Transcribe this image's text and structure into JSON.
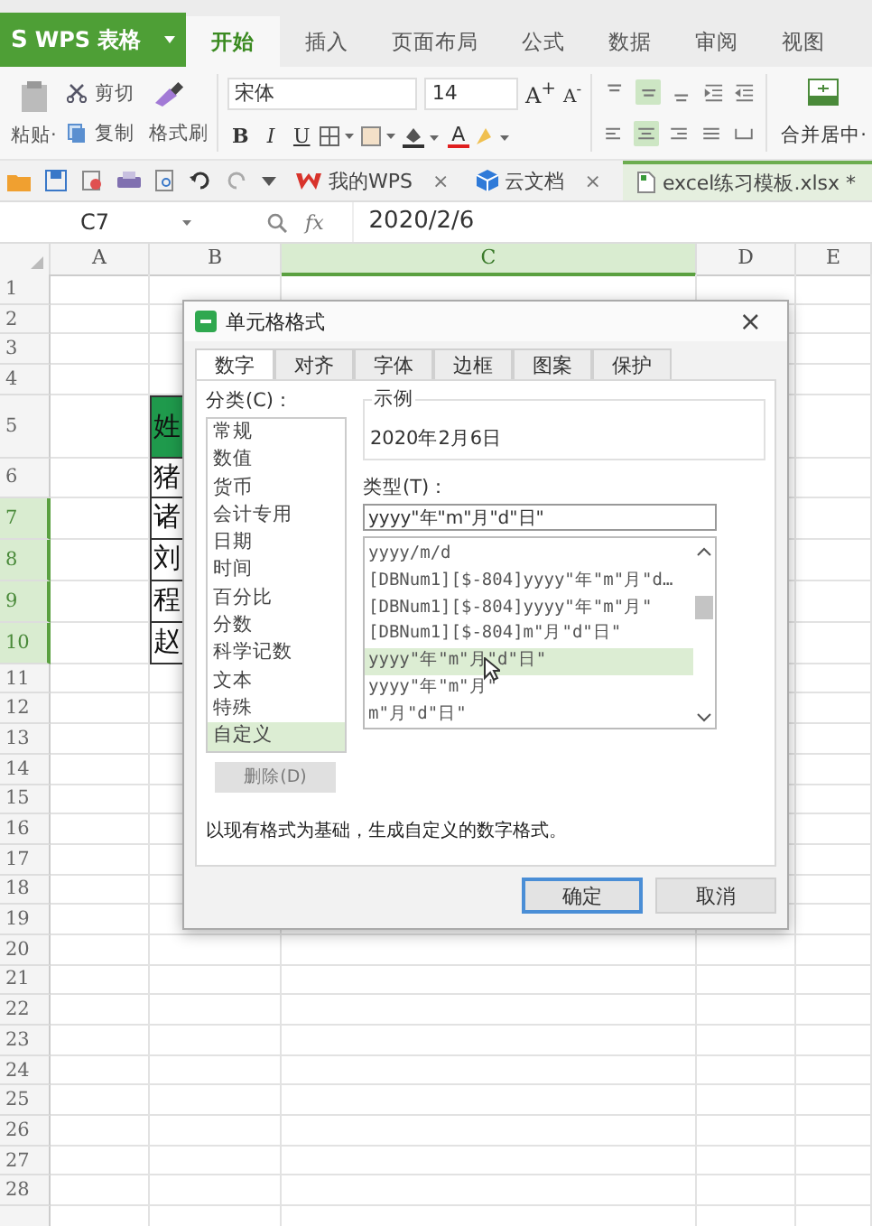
{
  "app": {
    "logo": "S",
    "name": "WPS 表格"
  },
  "ribbon_tabs": [
    {
      "label": "开始",
      "selected": true
    },
    {
      "label": "插入",
      "selected": false
    },
    {
      "label": "页面布局",
      "selected": false
    },
    {
      "label": "公式",
      "selected": false
    },
    {
      "label": "数据",
      "selected": false
    },
    {
      "label": "审阅",
      "selected": false
    },
    {
      "label": "视图",
      "selected": false
    }
  ],
  "clipboard": {
    "paste": "粘贴·",
    "cut": "剪切",
    "copy": "复制",
    "format_painter": "格式刷"
  },
  "font": {
    "name": "宋体",
    "size": "14",
    "grow": "A$^{+}$",
    "shrink": "A$^{-}$",
    "bold": "B",
    "italic": "I",
    "underline": "U",
    "font_color_letter": "A"
  },
  "vertical_align": [
    {
      "selected": false
    },
    {
      "selected": true
    },
    {
      "selected": false
    }
  ],
  "horizontal_align": [
    {
      "selected": false
    },
    {
      "selected": true
    },
    {
      "selected": false
    },
    {
      "selected": false
    },
    {
      "selected": false
    }
  ],
  "merge": {
    "label": "合并居中·"
  },
  "doc_tabs": [
    {
      "label": "我的WPS",
      "close": "×",
      "selected": false,
      "kind": "wps"
    },
    {
      "label": "云文档",
      "close": "×",
      "selected": false,
      "kind": "cloud"
    },
    {
      "label": "excel练习模板.xlsx *",
      "selected": true,
      "kind": "file"
    }
  ],
  "formula_bar": {
    "cell": "C7",
    "fx": "fx",
    "value": "2020/2/6"
  },
  "columns": [
    {
      "label": "A",
      "selected": false
    },
    {
      "label": "B",
      "selected": false
    },
    {
      "label": "C",
      "selected": true
    },
    {
      "label": "D",
      "selected": false
    },
    {
      "label": "E",
      "selected": false
    }
  ],
  "rows": [
    {
      "label": "1",
      "selected": false
    },
    {
      "label": "2",
      "selected": false
    },
    {
      "label": "3",
      "selected": false
    },
    {
      "label": "4",
      "selected": false
    },
    {
      "label": "5",
      "selected": false,
      "b": {
        "text": "姓",
        "kind": "header"
      }
    },
    {
      "label": "6",
      "selected": false,
      "b": {
        "text": "猪",
        "kind": "data"
      }
    },
    {
      "label": "7",
      "selected": true,
      "b": {
        "text": "诸",
        "kind": "data"
      }
    },
    {
      "label": "8",
      "selected": true,
      "b": {
        "text": "刘",
        "kind": "data"
      }
    },
    {
      "label": "9",
      "selected": true,
      "b": {
        "text": "程",
        "kind": "data"
      }
    },
    {
      "label": "10",
      "selected": true,
      "b": {
        "text": "赵",
        "kind": "data"
      }
    },
    {
      "label": "11",
      "selected": false
    },
    {
      "label": "12",
      "selected": false
    },
    {
      "label": "13",
      "selected": false
    },
    {
      "label": "14",
      "selected": false
    },
    {
      "label": "15",
      "selected": false
    },
    {
      "label": "16",
      "selected": false
    },
    {
      "label": "17",
      "selected": false
    },
    {
      "label": "18",
      "selected": false
    },
    {
      "label": "19",
      "selected": false
    },
    {
      "label": "20",
      "selected": false
    },
    {
      "label": "21",
      "selected": false
    },
    {
      "label": "22",
      "selected": false
    },
    {
      "label": "23",
      "selected": false
    },
    {
      "label": "24",
      "selected": false
    },
    {
      "label": "25",
      "selected": false
    },
    {
      "label": "26",
      "selected": false
    },
    {
      "label": "27",
      "selected": false
    },
    {
      "label": "28",
      "selected": false
    }
  ],
  "dialog": {
    "title": "单元格格式",
    "close": "×",
    "tabs": [
      {
        "label": "数字",
        "selected": true
      },
      {
        "label": "对齐",
        "selected": false
      },
      {
        "label": "字体",
        "selected": false
      },
      {
        "label": "边框",
        "selected": false
      },
      {
        "label": "图案",
        "selected": false
      },
      {
        "label": "保护",
        "selected": false
      }
    ],
    "category_label": "分类(C)：",
    "categories": [
      {
        "label": "常规",
        "selected": false
      },
      {
        "label": "数值",
        "selected": false
      },
      {
        "label": "货币",
        "selected": false
      },
      {
        "label": "会计专用",
        "selected": false
      },
      {
        "label": "日期",
        "selected": false
      },
      {
        "label": "时间",
        "selected": false
      },
      {
        "label": "百分比",
        "selected": false
      },
      {
        "label": "分数",
        "selected": false
      },
      {
        "label": "科学记数",
        "selected": false
      },
      {
        "label": "文本",
        "selected": false
      },
      {
        "label": "特殊",
        "selected": false
      },
      {
        "label": "自定义",
        "selected": true
      }
    ],
    "delete_button": {
      "label": "删除(D)",
      "disabled": true
    },
    "sample": {
      "legend": "示例",
      "value": "2020年2月6日"
    },
    "type_label": "类型(T)：",
    "type_value": "yyyy\"年\"m\"月\"d\"日\"",
    "types": [
      {
        "label": "yyyy/m/d",
        "selected": false
      },
      {
        "label": "[DBNum1][$-804]yyyy\"年\"m\"月\"d…",
        "selected": false
      },
      {
        "label": "[DBNum1][$-804]yyyy\"年\"m\"月\"",
        "selected": false
      },
      {
        "label": "[DBNum1][$-804]m\"月\"d\"日\"",
        "selected": false
      },
      {
        "label": "yyyy\"年\"m\"月\"d\"日\"",
        "selected": true
      },
      {
        "label": "yyyy\"年\"m\"月\"",
        "selected": false
      },
      {
        "label": "m\"月\"d\"日\"",
        "selected": false
      }
    ],
    "description": "以现有格式为基础，生成自定义的数字格式。",
    "buttons": [
      {
        "label": "确定",
        "kind": "default"
      },
      {
        "label": "取消",
        "kind": "normal"
      }
    ]
  }
}
